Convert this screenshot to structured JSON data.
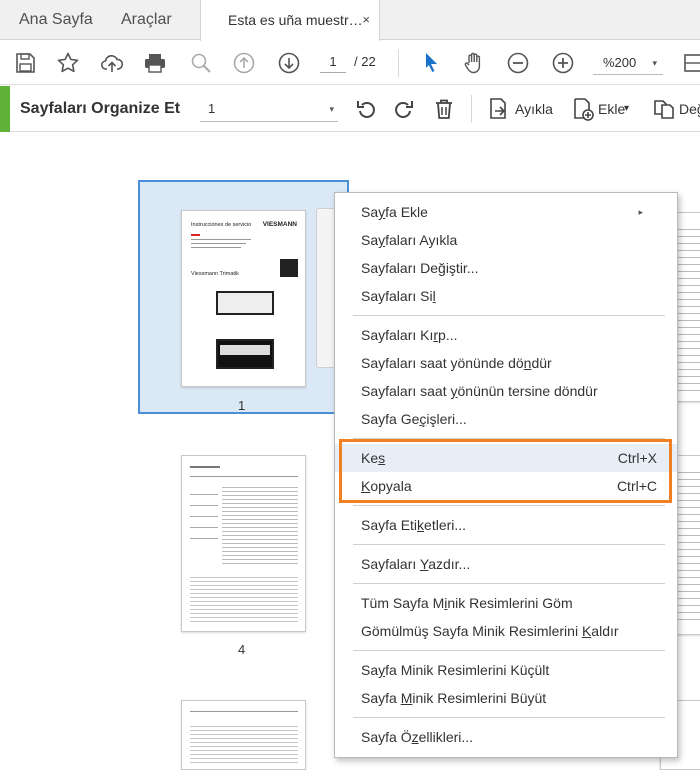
{
  "tabs": {
    "home": "Ana Sayfa",
    "tools": "Araçlar",
    "document": "Esta es uña muestr…",
    "close_glyph": "×"
  },
  "toolbar": {
    "page_current": "1",
    "page_total": "/ 22",
    "zoom": "%200",
    "icons": [
      "save-icon",
      "bookmark-star-icon",
      "upload-cloud-icon",
      "print-icon",
      "zoom-search-icon",
      "page-up-icon",
      "page-down-icon",
      "select-pointer-icon",
      "hand-tool-icon",
      "zoom-out-icon",
      "zoom-in-icon",
      "fit-page-icon"
    ]
  },
  "organize": {
    "title": "Sayfaları Organize Et",
    "page_select": "1",
    "extract_label": "Ayıkla",
    "insert_label": "Ekle",
    "replace_label": "Değ",
    "caret": "▾"
  },
  "pages": [
    {
      "number": "1",
      "doc_title": "Instrucciones de servicio",
      "brand": "VIESMANN",
      "product": "Viessmann Trimatik"
    },
    {
      "number": "4"
    }
  ],
  "context_menu": {
    "items": [
      {
        "pre": "Sa",
        "u": "y",
        "post": "fa Ekle",
        "submenu": "▸"
      },
      {
        "pre": "Sa",
        "u": "y",
        "post": "faları Ayıkla"
      },
      {
        "pre": "Sayfaları Değiştir...",
        "u": "",
        "post": ""
      },
      {
        "pre": "Sayfaları Si",
        "u": "l",
        "post": ""
      },
      {
        "pre": "Sayfaları Kı",
        "u": "r",
        "post": "p..."
      },
      {
        "pre": "Sayfaları saat yönünde dö",
        "u": "n",
        "post": "dür"
      },
      {
        "pre": "Sayfaları saat ",
        "u": "y",
        "post": "önünün tersine döndür"
      },
      {
        "pre": "Sayfa Ge",
        "u": "ç",
        "post": "işleri..."
      },
      {
        "pre": "Ke",
        "u": "s",
        "post": "",
        "shortcut": "Ctrl+X"
      },
      {
        "pre": "",
        "u": "K",
        "post": "opyala",
        "shortcut": "Ctrl+C"
      },
      {
        "pre": "Sayfa Eti",
        "u": "k",
        "post": "etleri..."
      },
      {
        "pre": "Sayfaları ",
        "u": "Y",
        "post": "azdır..."
      },
      {
        "pre": "Tüm Sayfa M",
        "u": "i",
        "post": "nik Resimlerini Göm"
      },
      {
        "pre": "Gömülmüş Sayfa Minik Resimlerini ",
        "u": "K",
        "post": "aldır"
      },
      {
        "pre": "Sa",
        "u": "y",
        "post": "fa Minik Resimlerini Küçült"
      },
      {
        "pre": "Sayfa ",
        "u": "M",
        "post": "inik Resimlerini Büyüt"
      },
      {
        "pre": "Sayfa Ö",
        "u": "z",
        "post": "ellikleri..."
      }
    ]
  },
  "colors": {
    "accent_green": "#5fb336",
    "selection_border": "#4a90d9",
    "highlight_orange": "#f08022",
    "pointer_blue": "#1a73c9"
  }
}
